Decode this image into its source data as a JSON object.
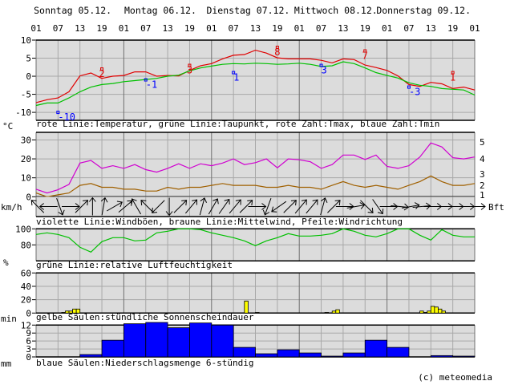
{
  "chart_data": [
    {
      "type": "line",
      "id": "temperature",
      "unit_label": "°C",
      "caption": "rote Linie:Temperatur, grüne Linie:Taupunkt, rote Zahl:Tmax, blaue Zahl:Tmin",
      "ylim": [
        -12,
        10
      ],
      "yticks": [
        10,
        5,
        0,
        -5,
        -10
      ],
      "x_step_hours": 3,
      "series": [
        {
          "name": "Temperatur",
          "color": "#e00000",
          "values": [
            -7.3,
            -6.5,
            -6,
            -4.3,
            0.1,
            0.9,
            -0.6,
            0,
            0.2,
            1.2,
            1.2,
            0,
            0.2,
            0.1,
            1.6,
            2.9,
            3.5,
            4.8,
            5.8,
            6,
            7.2,
            6.4,
            5.1,
            4.8,
            4.8,
            4.8,
            4.4,
            3.7,
            4.8,
            4.6,
            3.1,
            2.4,
            1.6,
            0.1,
            -2.3,
            -2.8,
            -1.7,
            -2.1,
            -3.4,
            -3,
            -3.8
          ]
        },
        {
          "name": "Taupunkt",
          "color": "#00c000",
          "values": [
            -8.1,
            -7.4,
            -7.4,
            -6,
            -4.3,
            -3,
            -2.3,
            -2,
            -1.5,
            -1.2,
            -0.9,
            -0.6,
            0,
            0.3,
            1.5,
            2.3,
            2.8,
            3.3,
            3.5,
            3.4,
            3.6,
            3.5,
            3.3,
            3.4,
            3.6,
            3.3,
            2.7,
            2.9,
            4,
            3.5,
            2.3,
            1,
            0.2,
            -0.5,
            -1.8,
            -2.5,
            -2.8,
            -3.4,
            -3.6,
            -3.8,
            -5.2
          ]
        }
      ],
      "tmax": [
        {
          "hour": 18,
          "value": 2,
          "label": "2"
        },
        {
          "hour": 42,
          "value": 3,
          "label": "3"
        },
        {
          "hour": 66,
          "value": 8,
          "label": "8"
        },
        {
          "hour": 90,
          "value": 7,
          "label": "7"
        },
        {
          "hour": 114,
          "value": 1,
          "label": "1"
        }
      ],
      "tmin": [
        {
          "hour": 6,
          "value": -10,
          "label": "-10"
        },
        {
          "hour": 30,
          "value": -1,
          "label": "-1"
        },
        {
          "hour": 54,
          "value": 1,
          "label": "1"
        },
        {
          "hour": 78,
          "value": 3,
          "label": "3"
        },
        {
          "hour": 102,
          "value": -3,
          "label": "-3"
        }
      ]
    },
    {
      "type": "line",
      "id": "wind",
      "unit_label": "km/h",
      "right_unit_label": "Bft",
      "caption": "violette Linie:Windböen, braune Linie:Mittelwind, Pfeile:Windrichtung",
      "ylim": [
        0,
        34
      ],
      "yticks": [
        30,
        20,
        10,
        0
      ],
      "bft_ticks": [
        {
          "label": "5",
          "kmh": 29
        },
        {
          "label": "4",
          "kmh": 20
        },
        {
          "label": "3",
          "kmh": 12
        },
        {
          "label": "2",
          "kmh": 6
        },
        {
          "label": "1",
          "kmh": 1
        }
      ],
      "x_step_hours": 3,
      "series": [
        {
          "name": "Windböen",
          "color": "#d000d0",
          "values": [
            4,
            2,
            3.7,
            6.5,
            17.8,
            19.2,
            15,
            16.4,
            15,
            17,
            14.3,
            13,
            15,
            17.4,
            15,
            17.4,
            16.4,
            17.8,
            20,
            17,
            18,
            20,
            15.3,
            20,
            19.5,
            18.5,
            15,
            17,
            22,
            22,
            19.7,
            22,
            16,
            15,
            16.4,
            21,
            28.4,
            26.3,
            20.6,
            20,
            21
          ]
        },
        {
          "name": "Mittelwind",
          "color": "#a06000",
          "values": [
            2,
            0,
            1,
            2,
            6,
            7,
            5,
            5,
            4,
            4,
            3,
            3,
            5,
            4,
            5,
            5,
            6,
            7,
            6,
            6,
            6,
            5,
            5,
            6,
            5,
            5,
            4,
            6,
            8,
            6,
            5,
            6,
            5,
            4,
            6,
            8,
            11,
            8,
            6,
            6,
            7
          ]
        }
      ],
      "direction_deg": [
        315,
        270,
        160,
        90,
        45,
        0,
        10,
        60,
        50,
        330,
        315,
        225,
        180,
        45,
        40,
        15,
        30,
        35,
        40,
        45,
        90,
        200,
        235,
        45,
        40,
        40,
        15,
        45,
        90,
        80,
        135,
        145,
        90,
        95,
        80,
        85,
        90,
        90,
        90,
        90,
        90
      ]
    },
    {
      "type": "line",
      "id": "humidity",
      "unit_label": "%",
      "caption": "grüne Linie:relative Luftfeuchtigkeit",
      "ylim": [
        60,
        100
      ],
      "yticks": [
        100,
        80
      ],
      "x_step_hours": 3,
      "series": [
        {
          "name": "relative Luftfeuchtigkeit",
          "color": "#00c000",
          "values": [
            93,
            95,
            93,
            89,
            77,
            71,
            84,
            89,
            89,
            85,
            86,
            95,
            97,
            100,
            100,
            99,
            95,
            92,
            89,
            85,
            79,
            85,
            89,
            94,
            91,
            91,
            92,
            94,
            100,
            97,
            92,
            90,
            94,
            100,
            100,
            92,
            86,
            99,
            92,
            90,
            90
          ]
        }
      ]
    },
    {
      "type": "bar",
      "id": "sunshine",
      "unit_label": "min",
      "caption": "gelbe Säulen:stündliche Sonnenscheindauer",
      "ylim": [
        0,
        60
      ],
      "yticks": [
        60,
        40,
        20,
        0
      ],
      "color": "#ffff00",
      "bars": [
        {
          "hour": 7,
          "value": 1
        },
        {
          "hour": 8,
          "value": 3
        },
        {
          "hour": 9,
          "value": 3
        },
        {
          "hour": 10,
          "value": 6
        },
        {
          "hour": 11,
          "value": 6
        },
        {
          "hour": 57,
          "value": 18
        },
        {
          "hour": 60,
          "value": 1
        },
        {
          "hour": 79,
          "value": 1
        },
        {
          "hour": 81,
          "value": 3
        },
        {
          "hour": 82,
          "value": 5
        },
        {
          "hour": 105,
          "value": 3
        },
        {
          "hour": 106,
          "value": 1
        },
        {
          "hour": 107,
          "value": 3
        },
        {
          "hour": 108,
          "value": 10
        },
        {
          "hour": 109,
          "value": 9
        },
        {
          "hour": 110,
          "value": 6
        },
        {
          "hour": 111,
          "value": 3
        }
      ]
    },
    {
      "type": "bar",
      "id": "precipitation",
      "unit_label": "mm",
      "caption": "blaue Säulen:Niederschlagsmenge 6-stündig",
      "ylim": [
        0,
        12
      ],
      "yticks": [
        12,
        9,
        6,
        3,
        0
      ],
      "color": "#0000ff",
      "interval_hours": 6,
      "values": [
        0,
        0,
        0.9,
        6.3,
        12.5,
        13,
        11,
        12.8,
        12,
        3.6,
        1.2,
        2.7,
        1.5,
        0.3,
        1.5,
        6.3,
        3.6,
        0,
        0.5,
        0.3
      ]
    }
  ],
  "x_axis": {
    "hours_total": 120,
    "hour_labels": [
      "01",
      "07",
      "13",
      "19",
      "01",
      "07",
      "13",
      "19",
      "01",
      "07",
      "13",
      "19",
      "01",
      "07",
      "13",
      "19",
      "01",
      "07",
      "13",
      "19",
      "01"
    ],
    "days": [
      "Sonntag 05.12.",
      "Montag 06.12.",
      "Dienstag 07.12.",
      "Mittwoch 08.12.",
      "Donnerstag 09.12."
    ]
  },
  "copyright": "(c) meteomedia"
}
